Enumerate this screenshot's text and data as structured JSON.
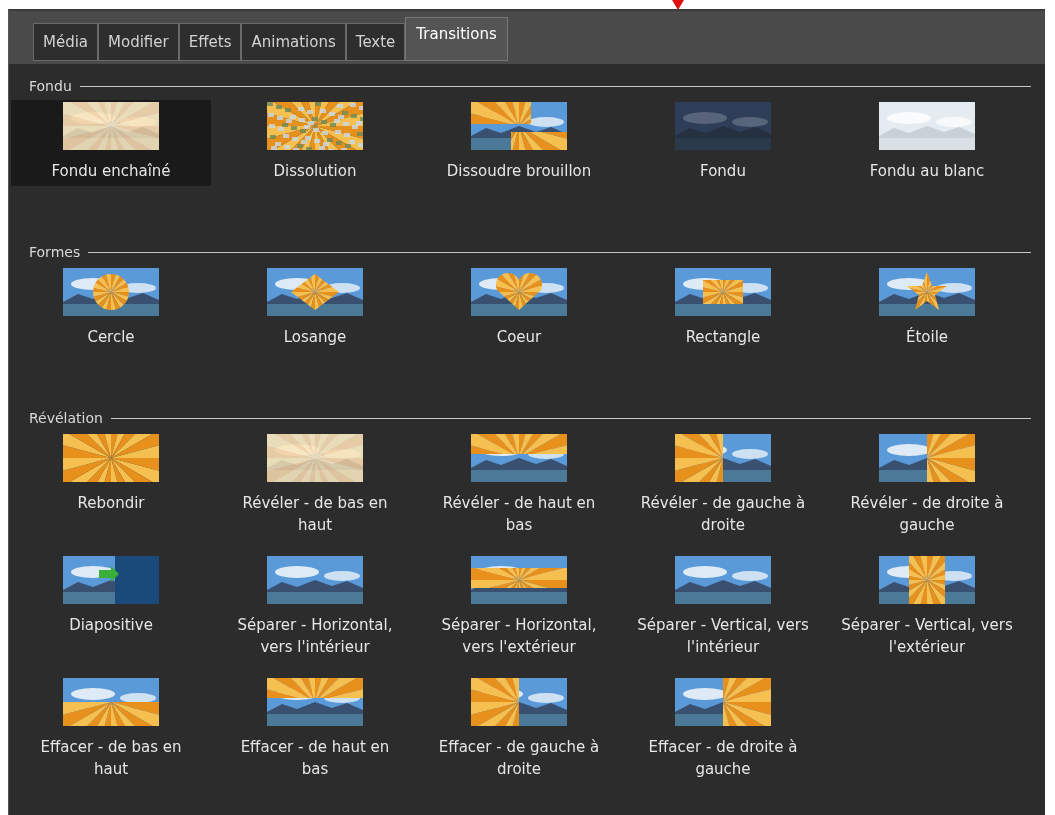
{
  "tabs": [
    {
      "label": "Média",
      "selected": false
    },
    {
      "label": "Modifier",
      "selected": false
    },
    {
      "label": "Effets",
      "selected": false
    },
    {
      "label": "Animations",
      "selected": false
    },
    {
      "label": "Texte",
      "selected": false
    },
    {
      "label": "Transitions",
      "selected": true
    }
  ],
  "sections": [
    {
      "title": "Fondu",
      "items": [
        {
          "label": "Fondu enchaîné",
          "selected": true,
          "kind": "haze"
        },
        {
          "label": "Dissolution",
          "selected": false,
          "kind": "dissolve"
        },
        {
          "label": "Dissoudre brouillon",
          "selected": false,
          "kind": "patchy"
        },
        {
          "label": "Fondu",
          "selected": false,
          "kind": "dark"
        },
        {
          "label": "Fondu au blanc",
          "selected": false,
          "kind": "white"
        }
      ]
    },
    {
      "title": "Formes",
      "items": [
        {
          "label": "Cercle",
          "selected": false,
          "kind": "circle"
        },
        {
          "label": "Losange",
          "selected": false,
          "kind": "diamond"
        },
        {
          "label": "Coeur",
          "selected": false,
          "kind": "heart"
        },
        {
          "label": "Rectangle",
          "selected": false,
          "kind": "rect"
        },
        {
          "label": "Étoile",
          "selected": false,
          "kind": "star"
        }
      ]
    },
    {
      "title": "Révélation",
      "items": [
        {
          "label": "Rebondir",
          "selected": false,
          "kind": "full"
        },
        {
          "label": "Révéler - de bas en haut",
          "selected": false,
          "kind": "haze"
        },
        {
          "label": "Révéler - de haut en bas",
          "selected": false,
          "kind": "top"
        },
        {
          "label": "Révéler - de gauche à droite",
          "selected": false,
          "kind": "left"
        },
        {
          "label": "Révéler - de droite à gauche",
          "selected": false,
          "kind": "right"
        },
        {
          "label": "Diapositive",
          "selected": false,
          "kind": "slide"
        },
        {
          "label": "Séparer - Horizontal, vers l'intérieur",
          "selected": false,
          "kind": "outer-h"
        },
        {
          "label": "Séparer - Horizontal, vers l'extérieur",
          "selected": false,
          "kind": "center-h"
        },
        {
          "label": "Séparer - Vertical, vers l'intérieur",
          "selected": false,
          "kind": "outer-v"
        },
        {
          "label": "Séparer - Vertical, vers l'extérieur",
          "selected": false,
          "kind": "center-v"
        },
        {
          "label": "Effacer - de bas en haut",
          "selected": false,
          "kind": "bottom"
        },
        {
          "label": "Effacer - de haut en bas",
          "selected": false,
          "kind": "top"
        },
        {
          "label": "Effacer - de gauche à droite",
          "selected": false,
          "kind": "left"
        },
        {
          "label": "Effacer - de droite à gauche",
          "selected": false,
          "kind": "right"
        }
      ]
    }
  ]
}
